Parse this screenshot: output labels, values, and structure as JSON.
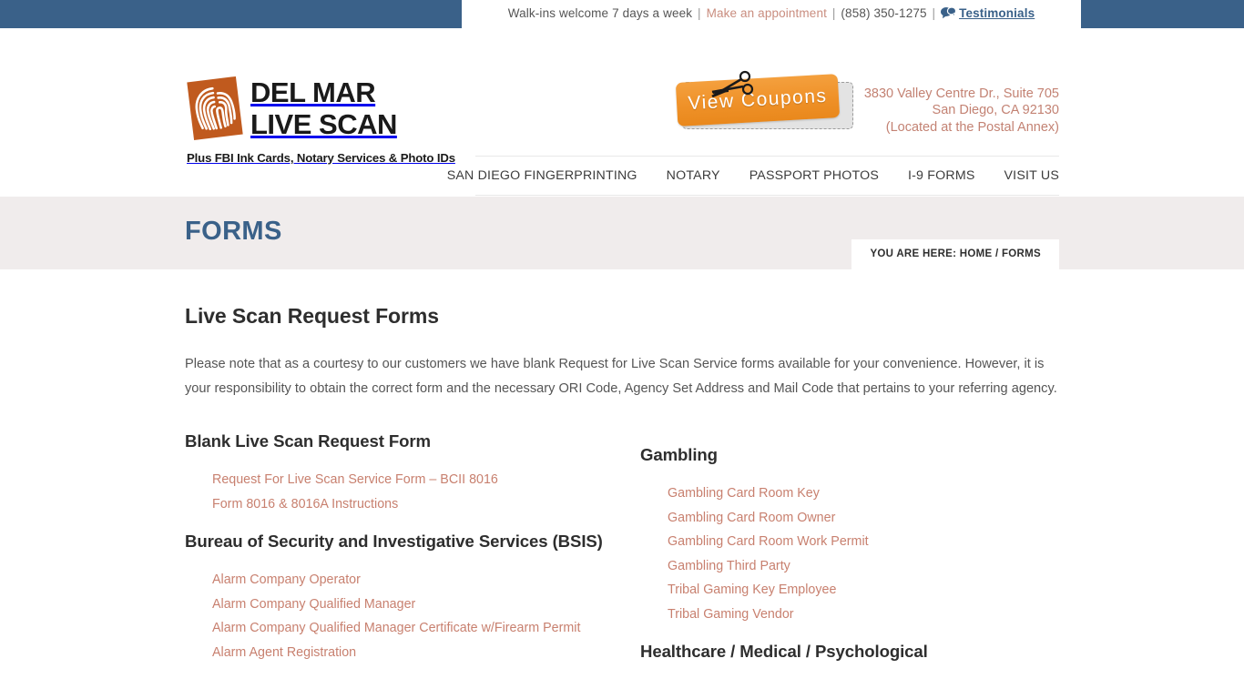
{
  "topbar": {
    "hours_text": "Walk-ins welcome 7 days a week",
    "sep1": "|",
    "appointment_link": "Make an appointment",
    "sep2": "|",
    "phone": "(858) 350-1275",
    "sep3": "|",
    "testimonials_label": "Testimonials",
    "testimonials_icon": "speech-bubbles-icon",
    "bg_color": "#3a6189",
    "link_color": "#c98d7f"
  },
  "header": {
    "logo": {
      "line1": "DEL MAR",
      "line2": "LIVE SCAN",
      "tagline": "Plus FBI Ink Cards, Notary Services & Photo IDs",
      "mark_icon": "fingerprint-icon",
      "mark_color": "#c05a1e"
    },
    "coupon": {
      "label": "View Coupons",
      "icon": "scissors-icon",
      "color": "#ef9128"
    },
    "address": {
      "line1": "3830 Valley Centre Dr., Suite 705",
      "line2": "San Diego, CA 92130",
      "line3": "(Located at the Postal Annex)",
      "color": "#c38273"
    },
    "nav": [
      {
        "label": "SAN DIEGO FINGERPRINTING"
      },
      {
        "label": "NOTARY"
      },
      {
        "label": "PASSPORT PHOTOS"
      },
      {
        "label": "I-9 FORMS"
      },
      {
        "label": "VISIT US"
      }
    ]
  },
  "banner": {
    "title": "FORMS",
    "title_color": "#3a6189",
    "bg_color": "#f0ecec",
    "breadcrumb": "YOU ARE HERE: HOME / FORMS"
  },
  "main": {
    "heading": "Live Scan Request Forms",
    "intro": "Please note that as a courtesy to our customers we have blank Request for Live Scan Service forms available for your convenience. However, it is your responsibility to obtain the correct form and the necessary ORI Code, Agency Set Address and Mail Code that pertains to your referring agency.",
    "link_color": "#c8806f",
    "left_column": [
      {
        "heading": "Blank Live Scan Request Form",
        "links": [
          "Request For Live Scan Service Form – BCII 8016",
          "Form 8016 & 8016A Instructions"
        ]
      },
      {
        "heading": "Bureau of Security and Investigative Services (BSIS)",
        "links": [
          "Alarm Company Operator",
          "Alarm Company Qualified Manager",
          "Alarm Company Qualified Manager Certificate w/Firearm Permit",
          "Alarm Agent Registration"
        ]
      }
    ],
    "right_column": [
      {
        "heading": "Gambling",
        "links": [
          "Gambling Card Room Key",
          "Gambling Card Room Owner",
          "Gambling Card Room Work Permit",
          "Gambling Third Party",
          "Tribal Gaming Key Employee",
          "Tribal Gaming Vendor"
        ]
      },
      {
        "heading": "Healthcare / Medical / Psychological",
        "links": []
      }
    ]
  }
}
